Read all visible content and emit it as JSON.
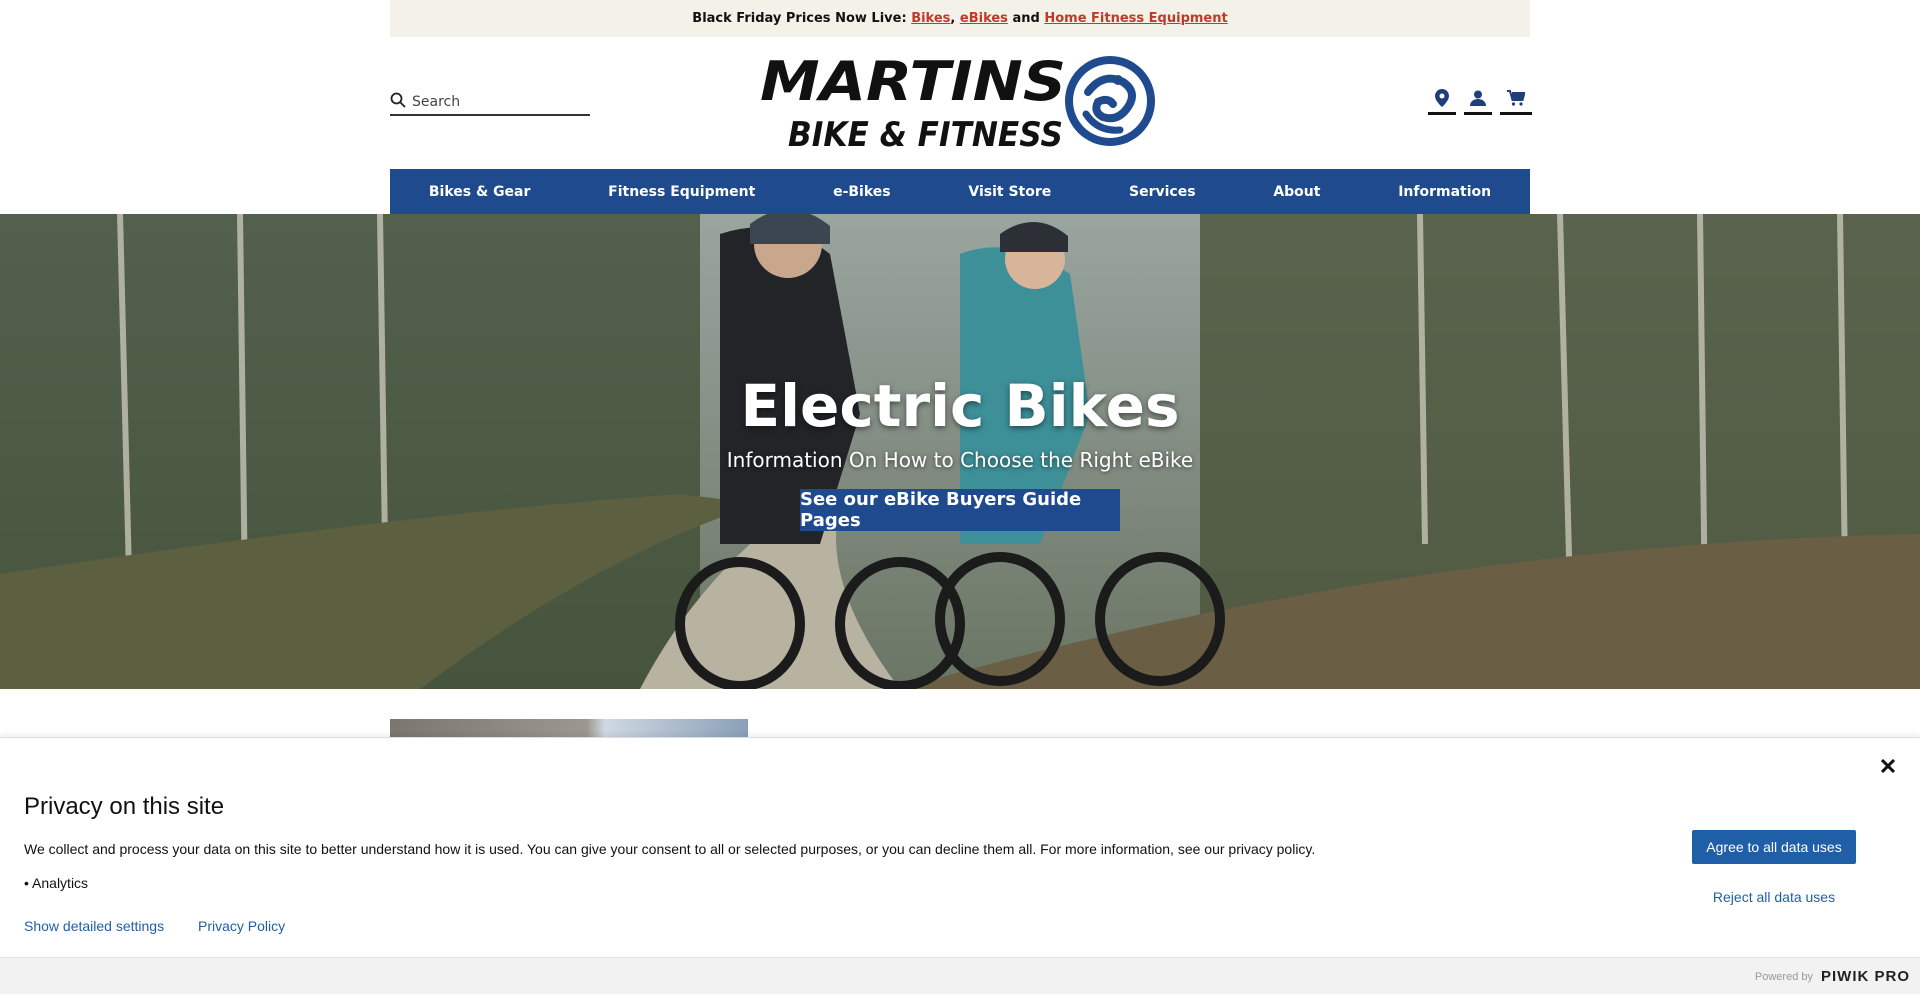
{
  "announcement": {
    "prefix": "Black Friday Prices Now Live:",
    "link_bikes": "Bikes",
    "sep1": ",",
    "link_ebikes": "eBikes",
    "and": "and",
    "link_fitness": "Home Fitness Equipment"
  },
  "search": {
    "placeholder": "Search",
    "icon": "search-icon"
  },
  "logo": {
    "line1": "MARTINS",
    "line2": "BIKE & FITNESS",
    "color": "#111111",
    "emblem_color": "#1f4b8e"
  },
  "header_icons": [
    "location-pin-icon",
    "account-icon",
    "cart-icon"
  ],
  "nav": {
    "bg": "#1f4b8e",
    "items": [
      "Bikes & Gear",
      "Fitness Equipment",
      "e-Bikes",
      "Visit Store",
      "Services",
      "About",
      "Information"
    ]
  },
  "hero": {
    "title": "Electric Bikes",
    "subtitle": "Information On How to Choose the Right eBike",
    "cta": "See our eBike Buyers Guide Pages"
  },
  "privacy": {
    "title": "Privacy on this site",
    "text": "We collect and process your data on this site to better understand how it is used. You can give your consent to all or selected purposes, or you can decline them all. For more information, see our privacy policy.",
    "list_bullet": "•",
    "list_item": "Analytics",
    "show_settings": "Show detailed settings",
    "policy_link": "Privacy Policy",
    "agree": "Agree to all data uses",
    "reject": "Reject all data uses",
    "close": "✕"
  },
  "powered": {
    "label": "Powered by",
    "brand": "PIWIK PRO"
  }
}
